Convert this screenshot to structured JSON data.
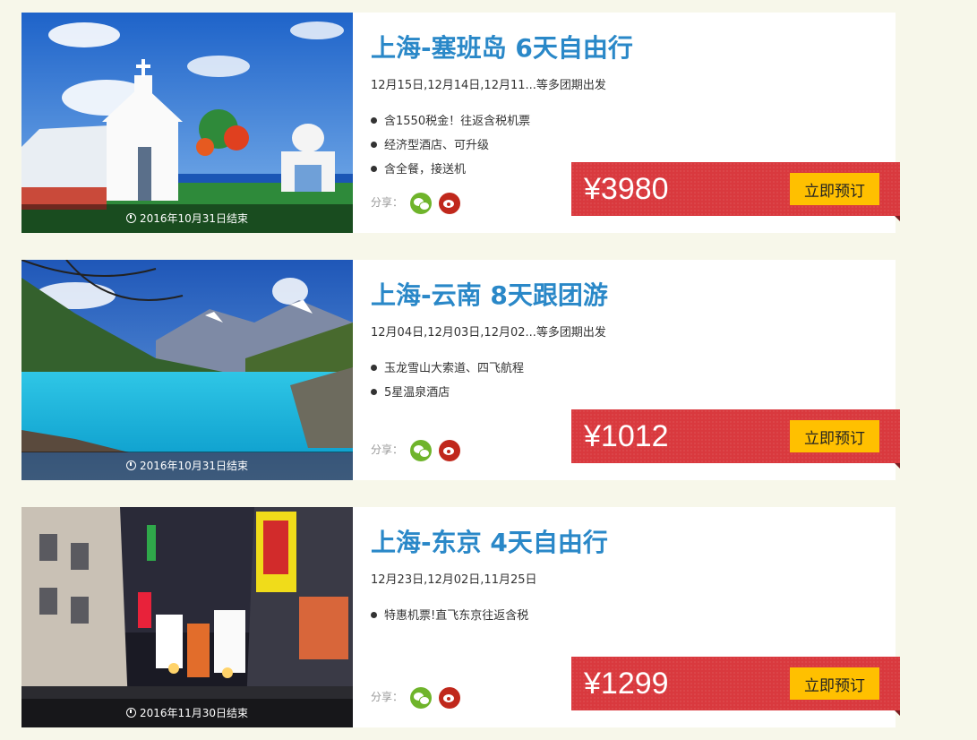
{
  "share_label": "分享：",
  "book_label": "立即预订",
  "tours": [
    {
      "title": "上海-塞班岛 6天自由行",
      "dates": "12月15日,12月14日,12月11...等多团期出发",
      "features": [
        "含1550税金！往返含税机票",
        "经济型酒店、可升级",
        "含全餐，接送机"
      ],
      "ends": "2016年10月31日结束",
      "price": "¥3980"
    },
    {
      "title": "上海-云南 8天跟团游",
      "dates": "12月04日,12月03日,12月02...等多团期出发",
      "features": [
        "玉龙雪山大索道、四飞航程",
        "5星温泉酒店"
      ],
      "ends": "2016年10月31日结束",
      "price": "¥1012"
    },
    {
      "title": "上海-东京 4天自由行",
      "dates": "12月23日,12月02日,11月25日",
      "features": [
        "特惠机票!直飞东京往返含税"
      ],
      "ends": "2016年11月30日结束",
      "price": "¥1299"
    }
  ]
}
